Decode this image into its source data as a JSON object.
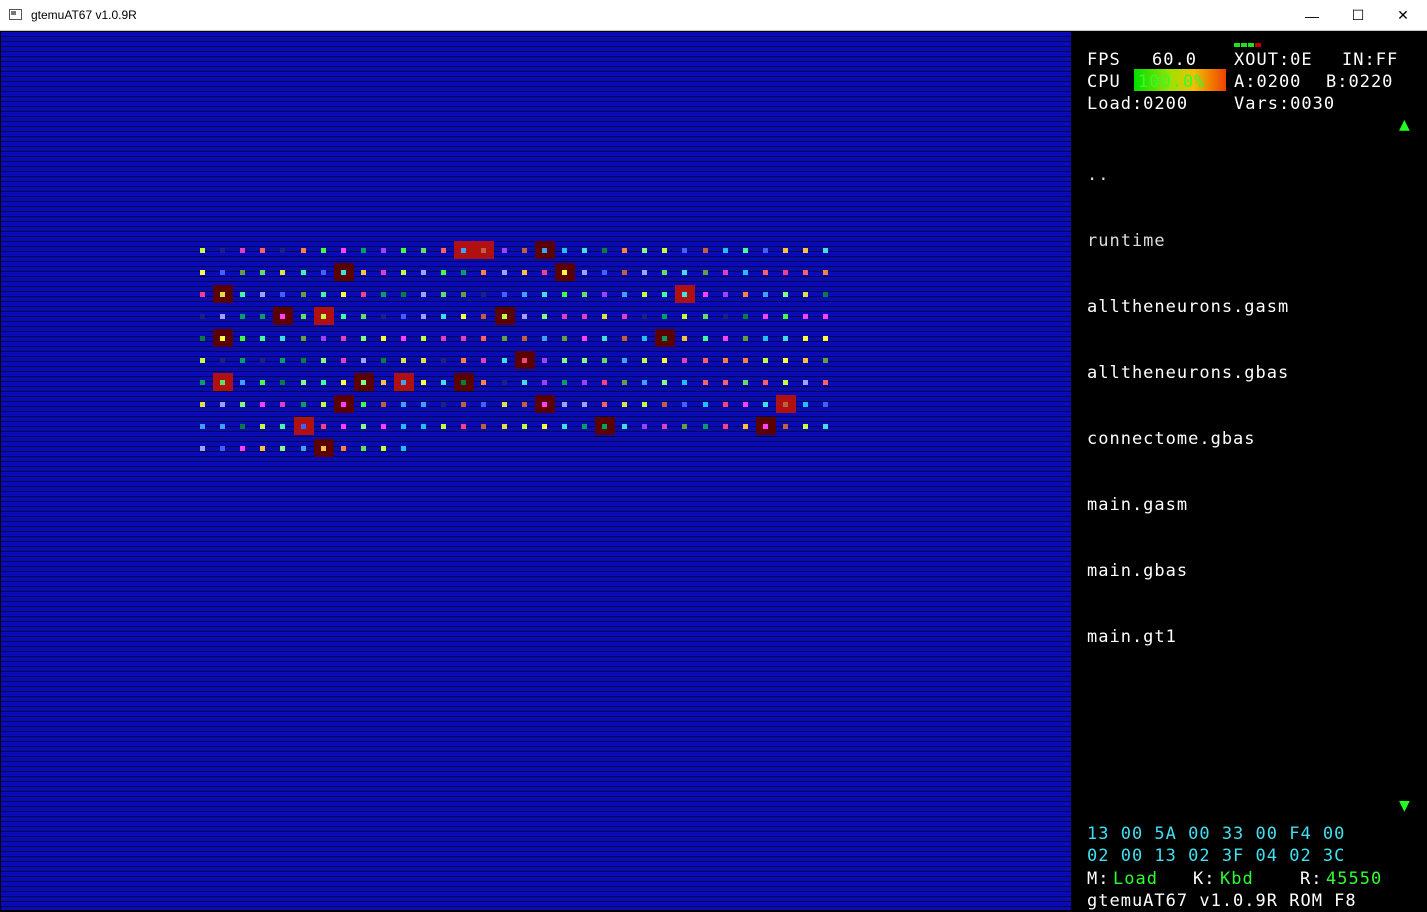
{
  "window": {
    "title": "gtemuAT67 v1.0.9R",
    "minimize_glyph": "—",
    "maximize_glyph": "☐",
    "close_glyph": "✕"
  },
  "stats": {
    "fps_label": "FPS",
    "fps_value": "60.0",
    "xout": "XOUT:0E",
    "in": "IN:FF",
    "cpu_label": "CPU",
    "cpu_value": "100.0%",
    "a_reg": "A:0200",
    "b_reg": "B:0220",
    "load": "Load:0200",
    "vars": "Vars:0030"
  },
  "files": {
    "items": [
      "..",
      "runtime",
      "alltheneurons.gasm",
      "alltheneurons.gbas",
      "connectome.gbas",
      "main.gasm",
      "main.gbas",
      "main.gt1"
    ]
  },
  "hexdump": {
    "row1": "13 00 5A 00 33 00 F4 00",
    "row2": "02 00 13 02 3F 04 02 3C"
  },
  "modes": {
    "m_label": "M:",
    "m_value": "Load",
    "k_label": "K:",
    "k_value": "Kbd",
    "r_label": "R:",
    "r_value": "45550"
  },
  "footer": {
    "text": "gtemuAT67 v1.0.9R ROM F8"
  },
  "colors": {
    "led_on": "#20e020",
    "led_off": "#c00000",
    "scroll_arrow": "#20ff20",
    "hex_text": "#40e0f0",
    "mode_value": "#30ff30",
    "screen_blue": "#0a0ab8"
  }
}
